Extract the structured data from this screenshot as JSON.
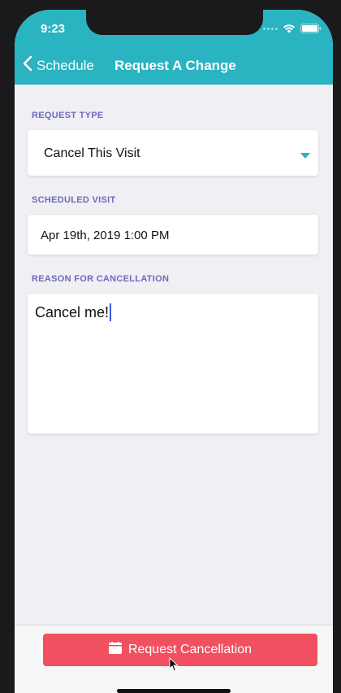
{
  "status_bar": {
    "time": "9:23",
    "icons": [
      "signal-icon",
      "wifi-icon",
      "battery-icon"
    ]
  },
  "nav": {
    "back_label": "Schedule",
    "back_icon": "chevron-left-icon",
    "title": "Request A Change"
  },
  "form": {
    "request_type": {
      "label": "REQUEST TYPE",
      "value": "Cancel This Visit",
      "icon": "caret-down-icon"
    },
    "scheduled_visit": {
      "label": "SCHEDULED VISIT",
      "value": "Apr 19th, 2019 1:00 PM"
    },
    "reason": {
      "label": "REASON FOR CANCELLATION",
      "value": "Cancel me!"
    }
  },
  "footer": {
    "button_label": "Request Cancellation",
    "button_icon": "calendar-icon"
  },
  "colors": {
    "header": "#2ab3c0",
    "section_label": "#6d6bbd",
    "primary_button": "#f0505f",
    "caret": "#2ab3c0",
    "background": "#efeff4"
  }
}
